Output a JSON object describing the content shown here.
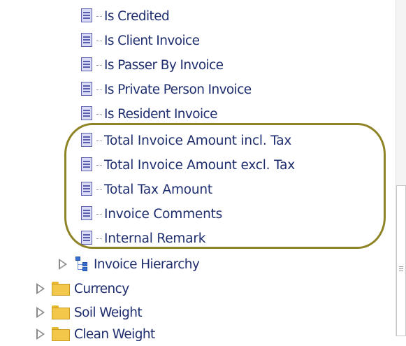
{
  "tree": {
    "columns": [
      {
        "label": "Is Credited"
      },
      {
        "label": "Is Client Invoice"
      },
      {
        "label": "Is Passer By Invoice"
      },
      {
        "label": "Is Private Person Invoice"
      },
      {
        "label": "Is Resident Invoice"
      },
      {
        "label": "Total Invoice Amount incl. Tax"
      },
      {
        "label": "Total Invoice Amount excl. Tax"
      },
      {
        "label": "Total Tax Amount"
      },
      {
        "label": "Invoice Comments"
      },
      {
        "label": "Internal Remark"
      }
    ],
    "hierarchy": {
      "label": "Invoice Hierarchy",
      "icon": "hierarchy-icon"
    },
    "folders": [
      {
        "label": "Currency"
      },
      {
        "label": "Soil Weight"
      },
      {
        "label": "Clean Weight"
      }
    ]
  },
  "colors": {
    "label_text": "#1e2d6e",
    "highlight_outline": "#8f8425",
    "folder": "#f2c84a",
    "column_icon": "#5a5cb0"
  }
}
